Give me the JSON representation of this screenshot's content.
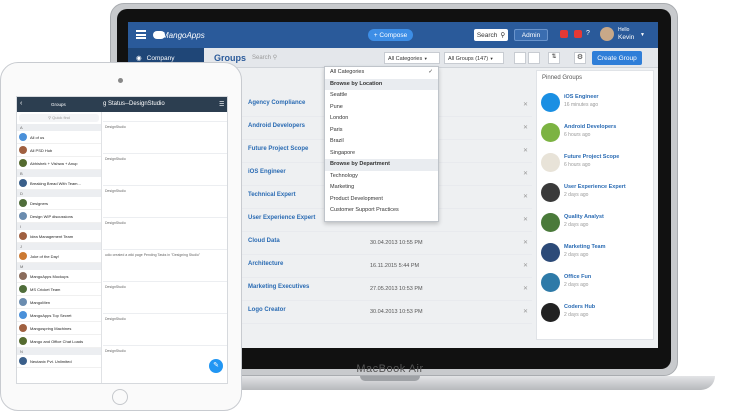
{
  "laptop": {
    "brand_label": "MacBook Air",
    "app": {
      "logo": "MangoApps",
      "compose_label": "+ Compose",
      "search_label": "Search",
      "admin_label": "Admin",
      "greeting": "Hello",
      "user_name": "Kevin",
      "nav_company": "Company",
      "page_title": "Groups",
      "search_placeholder": "Search",
      "category_select": "All Categories",
      "groups_select": "All Groups (147)",
      "create_group_label": "Create Group"
    },
    "dropdown": {
      "items": [
        {
          "label": "All Categories",
          "selected": true
        },
        {
          "label": "Browse by Location",
          "header": true
        },
        {
          "label": "Seattle"
        },
        {
          "label": "Pune"
        },
        {
          "label": "London"
        },
        {
          "label": "Paris"
        },
        {
          "label": "Brazil"
        },
        {
          "label": "Singapore"
        },
        {
          "label": "Browse by Department",
          "header": true
        },
        {
          "label": "Technology"
        },
        {
          "label": "Marketing"
        },
        {
          "label": "Product Development"
        },
        {
          "label": "Customer Support Practices"
        }
      ]
    },
    "groups": [
      {
        "name": "Agency Compliance",
        "date": ""
      },
      {
        "name": "Android Developers",
        "date": ""
      },
      {
        "name": "Future Project Scope",
        "date": ""
      },
      {
        "name": "iOS Engineer",
        "date": ""
      },
      {
        "name": "Technical Expert",
        "date": ""
      },
      {
        "name": "User Experience Expert",
        "date": "11.02.2016 4:37 PM"
      },
      {
        "name": "Cloud Data",
        "date": "30.04.2013 10:55 PM"
      },
      {
        "name": "Architecture",
        "date": "16.11.2015 5:44 PM"
      },
      {
        "name": "Marketing Executives",
        "date": "27.05.2013 10:53 PM"
      },
      {
        "name": "Logo Creator",
        "date": "30.04.2013 10:53 PM"
      }
    ],
    "pinned_title": "Pinned Groups",
    "pinned": [
      {
        "name": "iOS Engineer",
        "time": "16 minutes ago",
        "color": "#1a8fe3"
      },
      {
        "name": "Android Developers",
        "time": "6 hours ago",
        "color": "#7cb342"
      },
      {
        "name": "Future Project Scope",
        "time": "6 hours ago",
        "color": "#e8e3d8"
      },
      {
        "name": "User Experience Expert",
        "time": "2 days ago",
        "color": "#3a3a3a"
      },
      {
        "name": "Quality Analyst",
        "time": "2 days ago",
        "color": "#4a7a3a"
      },
      {
        "name": "Marketing Team",
        "time": "2 days ago",
        "color": "#2c4a78"
      },
      {
        "name": "Office Fun",
        "time": "2 days ago",
        "color": "#2e7aa8"
      },
      {
        "name": "Coders Hub",
        "time": "2 days ago",
        "color": "#222222"
      }
    ]
  },
  "ipad": {
    "title": "Groups",
    "chat_title": "g Status--DesignStudio",
    "quick_find": "Quick find",
    "groups": [
      {
        "letter": "A"
      },
      {
        "name": "All of us"
      },
      {
        "name": "All PSD Hub"
      },
      {
        "name": "Abhishek + Vishwa + Anup"
      },
      {
        "letter": "B"
      },
      {
        "name": "Breaking Bread With Team..."
      },
      {
        "letter": "D"
      },
      {
        "name": "Designers"
      },
      {
        "name": "Design WIP discussions"
      },
      {
        "letter": "I"
      },
      {
        "name": "Idea Management Team"
      },
      {
        "letter": "J"
      },
      {
        "name": "Joke of the Day!"
      },
      {
        "letter": "M"
      },
      {
        "name": "MangoApps Mockups"
      },
      {
        "name": "MS Cricket Team"
      },
      {
        "name": "MangoMen"
      },
      {
        "name": "MangoApps Top Secret"
      },
      {
        "name": "Mangospring Machines"
      },
      {
        "name": "Mango and Office Chat Loads"
      },
      {
        "letter": "N"
      },
      {
        "name": "Neutanix Pvt. Unlimited"
      }
    ],
    "chat_snippets": [
      "DesignStudio",
      "DesignStudio",
      "DesignStudio",
      "DesignStudio",
      "udio created a wiki page Pending Tasks in \"Designing Studio\"",
      "DesignStudio",
      "DesignStudio",
      "DesignStudio"
    ]
  }
}
